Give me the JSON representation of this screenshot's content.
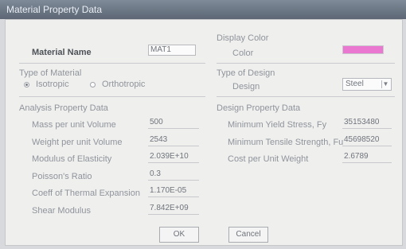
{
  "window": {
    "title": "Material Property Data"
  },
  "left": {
    "material_name_label": "Material Name",
    "material_name_value": "MAT1",
    "type_section_label": "Type of Material",
    "radio_isotropic_label": "Isotropic",
    "radio_orthotropic_label": "Orthotropic",
    "analysis_section_label": "Analysis Property Data",
    "fields": [
      {
        "label": "Mass per unit Volume",
        "value": "500"
      },
      {
        "label": "Weight per unit Volume",
        "value": "2543"
      },
      {
        "label": "Modulus of Elasticity",
        "value": "2.039E+10"
      },
      {
        "label": "Poisson's Ratio",
        "value": "0.3"
      },
      {
        "label": "Coeff of Thermal Expansion",
        "value": "1.170E-05"
      },
      {
        "label": "Shear Modulus",
        "value": "7.842E+09"
      }
    ]
  },
  "right": {
    "display_color_label": "Display Color",
    "color_label": "Color",
    "type_design_label": "Type of Design",
    "design_label": "Design",
    "design_value": "Steel",
    "design_section_label": "Design Property Data",
    "fields": [
      {
        "label": "Minimum Yield Stress, Fy",
        "value": "35153480"
      },
      {
        "label": "Minimum Tensile Strength, Fu",
        "value": "45698520"
      },
      {
        "label": "Cost per Unit Weight",
        "value": "2.6789"
      }
    ]
  },
  "buttons": {
    "ok": "OK",
    "cancel": "Cancel"
  },
  "colors": {
    "display_color": "#ea78d0"
  }
}
